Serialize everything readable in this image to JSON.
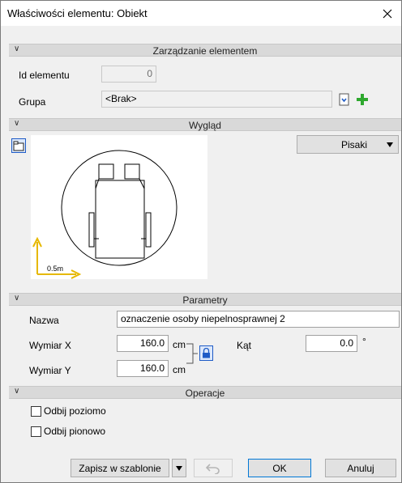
{
  "window": {
    "title": "Właściwości elementu: Obiekt"
  },
  "sections": {
    "management": "Zarządzanie elementem",
    "appearance": "Wygląd",
    "parameters": "Parametry",
    "operations": "Operacje"
  },
  "management": {
    "id_label": "Id elementu",
    "id_value": "0",
    "group_label": "Grupa",
    "group_value": "<Brak>"
  },
  "appearance": {
    "pens_button": "Pisaki",
    "scale_label": "0.5m"
  },
  "parameters": {
    "name_label": "Nazwa",
    "name_value": "oznaczenie osoby niepelnosprawnej 2",
    "dim_x_label": "Wymiar X",
    "dim_x_value": "160.0",
    "dim_y_label": "Wymiar Y",
    "dim_y_value": "160.0",
    "unit": "cm",
    "angle_label": "Kąt",
    "angle_value": "0.0",
    "angle_unit": "°"
  },
  "operations": {
    "flip_h_label": "Odbij poziomo",
    "flip_h_checked": false,
    "flip_v_label": "Odbij pionowo",
    "flip_v_checked": false
  },
  "footer": {
    "save_template": "Zapisz w szablonie",
    "ok": "OK",
    "cancel": "Anuluj"
  },
  "colors": {
    "section_bg": "#d9d9d9",
    "dialog_bg": "#f0f0f0",
    "add_icon": "#2ea82e",
    "axis_color": "#e6b800"
  }
}
